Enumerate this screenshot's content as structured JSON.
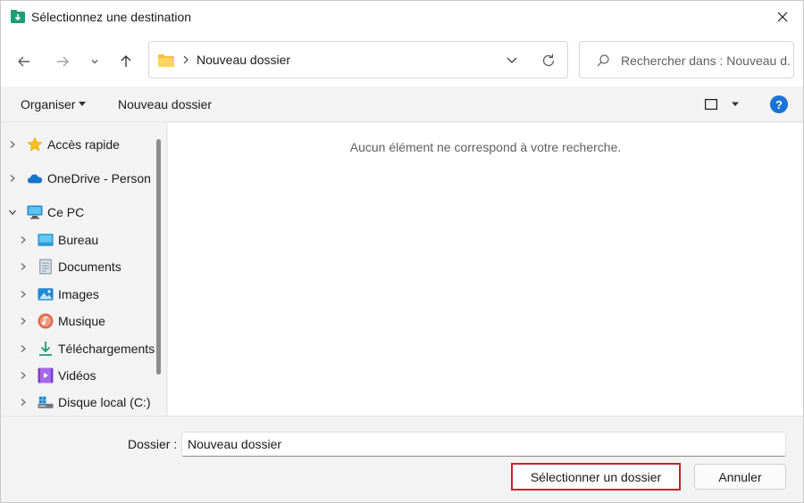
{
  "window": {
    "title": "Sélectionnez une destination",
    "close_label": "Fermer"
  },
  "nav": {
    "address_path": "Nouveau dossier",
    "search_placeholder": "Rechercher dans : Nouveau d..."
  },
  "commandbar": {
    "organize_label": "Organiser",
    "new_folder_label": "Nouveau dossier",
    "help_label": "?"
  },
  "sidebar": {
    "items": [
      {
        "label": "Accès rapide",
        "icon": "star-icon"
      },
      {
        "label": "OneDrive - Person",
        "icon": "cloud-icon"
      },
      {
        "label": "Ce PC",
        "icon": "monitor-icon"
      },
      {
        "label": "Bureau",
        "icon": "desktop-icon"
      },
      {
        "label": "Documents",
        "icon": "document-icon"
      },
      {
        "label": "Images",
        "icon": "image-icon"
      },
      {
        "label": "Musique",
        "icon": "music-icon"
      },
      {
        "label": "Téléchargements",
        "icon": "download-icon"
      },
      {
        "label": "Vidéos",
        "icon": "video-icon"
      },
      {
        "label": "Disque local (C:)",
        "icon": "drive-icon"
      }
    ]
  },
  "filepane": {
    "empty_message": "Aucun élément ne correspond à votre recherche."
  },
  "footer": {
    "folder_label": "Dossier :",
    "folder_value": "Nouveau dossier",
    "select_button": "Sélectionner un dossier",
    "cancel_button": "Annuler"
  },
  "colors": {
    "accent": "#1a73d9",
    "highlight_border": "#c9212f",
    "folder": "#f5c242"
  }
}
